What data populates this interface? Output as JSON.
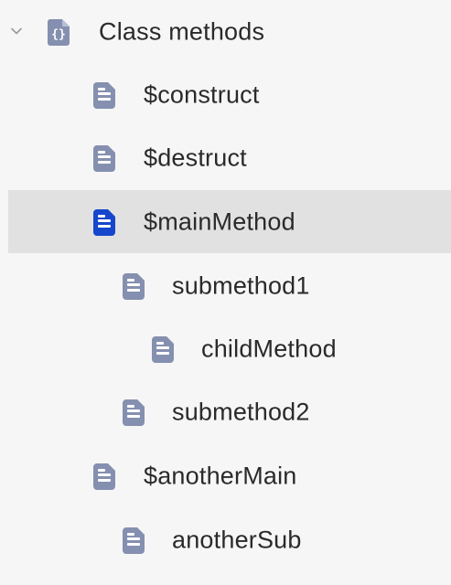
{
  "tree": {
    "root": {
      "label": "Class methods",
      "icon": "braces-file-icon",
      "expanded": true
    },
    "items": [
      {
        "label": "$construct",
        "icon": "document-icon",
        "level": 1,
        "selected": false
      },
      {
        "label": "$destruct",
        "icon": "document-icon",
        "level": 1,
        "selected": false
      },
      {
        "label": "$mainMethod",
        "icon": "document-icon",
        "level": 1,
        "selected": true
      },
      {
        "label": "submethod1",
        "icon": "document-icon",
        "level": 2,
        "selected": false
      },
      {
        "label": "childMethod",
        "icon": "document-icon",
        "level": 3,
        "selected": false
      },
      {
        "label": "submethod2",
        "icon": "document-icon",
        "level": 2,
        "selected": false
      },
      {
        "label": "$anotherMain",
        "icon": "document-icon",
        "level": 1,
        "selected": false
      },
      {
        "label": "anotherSub",
        "icon": "document-icon",
        "level": 2,
        "selected": false
      }
    ]
  },
  "colors": {
    "icon_default": "#8590b0",
    "icon_selected": "#1546cc",
    "selection_bg": "#e1e1e1",
    "text": "#2a2a2a"
  }
}
